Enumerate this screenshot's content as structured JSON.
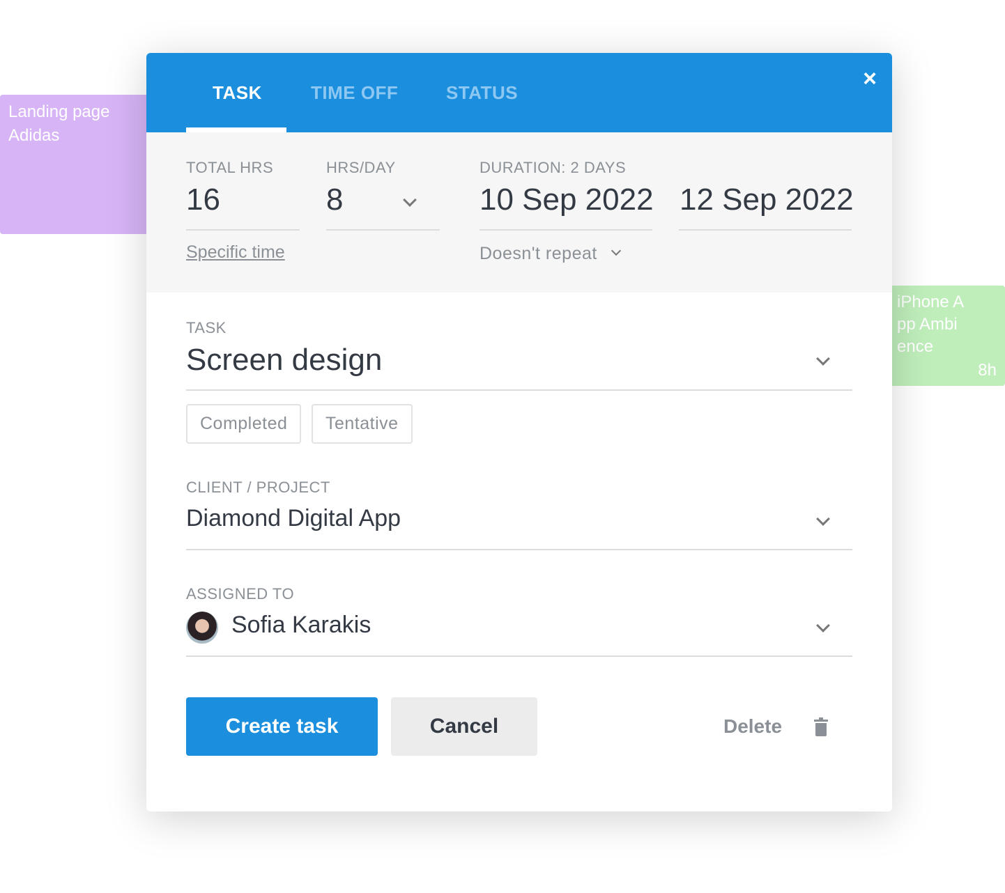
{
  "background_cards": [
    {
      "title": "Landing page Adidas",
      "color": "#d7b4f6"
    },
    {
      "title": "iPhone App Ambience",
      "hours": "8h",
      "color": "#bfeebb"
    }
  ],
  "tabs": [
    {
      "label": "TASK",
      "active": true
    },
    {
      "label": "TIME OFF",
      "active": false
    },
    {
      "label": "STATUS",
      "active": false
    }
  ],
  "close_icon": "×",
  "schedule": {
    "total_hrs_label": "TOTAL HRS",
    "total_hrs": "16",
    "hrs_day_label": "HRS/DAY",
    "hrs_day": "8",
    "duration_label": "DURATION:",
    "duration_value": "2 DAYS",
    "start_date": "10 Sep 2022",
    "end_date": "12 Sep 2022",
    "specific_time": "Specific time",
    "repeat": "Doesn't repeat"
  },
  "task": {
    "label": "TASK",
    "value": "Screen design",
    "tags": [
      "Completed",
      "Tentative"
    ]
  },
  "client": {
    "label": "CLIENT / PROJECT",
    "value": "Diamond Digital App"
  },
  "assigned": {
    "label": "ASSIGNED TO",
    "value": "Sofia Karakis"
  },
  "actions": {
    "create": "Create task",
    "cancel": "Cancel",
    "delete": "Delete"
  },
  "colors": {
    "primary": "#1b8fdd"
  }
}
